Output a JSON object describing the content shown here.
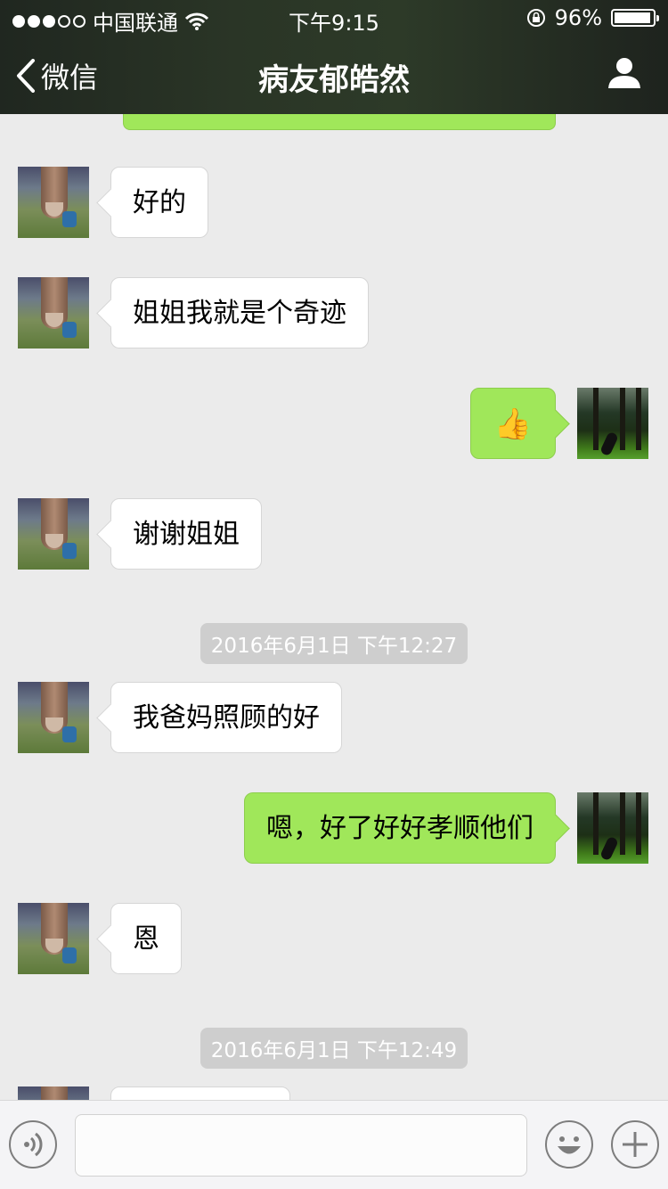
{
  "status_bar": {
    "carrier": "中国联通",
    "time": "下午9:15",
    "battery_text": "96%",
    "battery_level": 0.96
  },
  "nav": {
    "back_label": "微信",
    "title": "病友郁皓然"
  },
  "messages": [
    {
      "from": "friend",
      "text": "好的"
    },
    {
      "from": "friend",
      "text": "姐姐我就是个奇迹"
    },
    {
      "from": "me",
      "text": "👍"
    },
    {
      "from": "friend",
      "text": "谢谢姐姐"
    },
    {
      "from": "friend",
      "text": "我爸妈照顾的好"
    },
    {
      "from": "me",
      "text": "嗯，好了好好孝顺他们"
    },
    {
      "from": "friend",
      "text": "恩"
    }
  ],
  "timestamps": [
    "2016年6月1日 下午12:27",
    "2016年6月1日 下午12:49"
  ],
  "input": {
    "placeholder": ""
  },
  "colors": {
    "outgoing_bubble": "#a0e75a",
    "background": "#ebebeb"
  },
  "icons": [
    "chevron-left-icon",
    "person-icon",
    "voice-icon",
    "emoji-icon",
    "plus-icon",
    "wifi-icon",
    "lock-rotation-icon"
  ]
}
